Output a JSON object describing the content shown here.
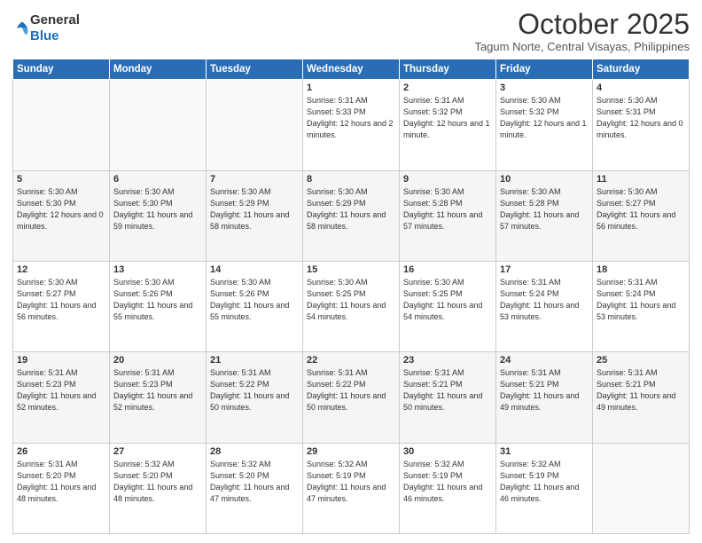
{
  "logo": {
    "general": "General",
    "blue": "Blue"
  },
  "header": {
    "month": "October 2025",
    "location": "Tagum Norte, Central Visayas, Philippines"
  },
  "weekdays": [
    "Sunday",
    "Monday",
    "Tuesday",
    "Wednesday",
    "Thursday",
    "Friday",
    "Saturday"
  ],
  "weeks": [
    [
      {
        "day": "",
        "sunrise": "",
        "sunset": "",
        "daylight": ""
      },
      {
        "day": "",
        "sunrise": "",
        "sunset": "",
        "daylight": ""
      },
      {
        "day": "",
        "sunrise": "",
        "sunset": "",
        "daylight": ""
      },
      {
        "day": "1",
        "sunrise": "Sunrise: 5:31 AM",
        "sunset": "Sunset: 5:33 PM",
        "daylight": "Daylight: 12 hours and 2 minutes."
      },
      {
        "day": "2",
        "sunrise": "Sunrise: 5:31 AM",
        "sunset": "Sunset: 5:32 PM",
        "daylight": "Daylight: 12 hours and 1 minute."
      },
      {
        "day": "3",
        "sunrise": "Sunrise: 5:30 AM",
        "sunset": "Sunset: 5:32 PM",
        "daylight": "Daylight: 12 hours and 1 minute."
      },
      {
        "day": "4",
        "sunrise": "Sunrise: 5:30 AM",
        "sunset": "Sunset: 5:31 PM",
        "daylight": "Daylight: 12 hours and 0 minutes."
      }
    ],
    [
      {
        "day": "5",
        "sunrise": "Sunrise: 5:30 AM",
        "sunset": "Sunset: 5:30 PM",
        "daylight": "Daylight: 12 hours and 0 minutes."
      },
      {
        "day": "6",
        "sunrise": "Sunrise: 5:30 AM",
        "sunset": "Sunset: 5:30 PM",
        "daylight": "Daylight: 11 hours and 59 minutes."
      },
      {
        "day": "7",
        "sunrise": "Sunrise: 5:30 AM",
        "sunset": "Sunset: 5:29 PM",
        "daylight": "Daylight: 11 hours and 58 minutes."
      },
      {
        "day": "8",
        "sunrise": "Sunrise: 5:30 AM",
        "sunset": "Sunset: 5:29 PM",
        "daylight": "Daylight: 11 hours and 58 minutes."
      },
      {
        "day": "9",
        "sunrise": "Sunrise: 5:30 AM",
        "sunset": "Sunset: 5:28 PM",
        "daylight": "Daylight: 11 hours and 57 minutes."
      },
      {
        "day": "10",
        "sunrise": "Sunrise: 5:30 AM",
        "sunset": "Sunset: 5:28 PM",
        "daylight": "Daylight: 11 hours and 57 minutes."
      },
      {
        "day": "11",
        "sunrise": "Sunrise: 5:30 AM",
        "sunset": "Sunset: 5:27 PM",
        "daylight": "Daylight: 11 hours and 56 minutes."
      }
    ],
    [
      {
        "day": "12",
        "sunrise": "Sunrise: 5:30 AM",
        "sunset": "Sunset: 5:27 PM",
        "daylight": "Daylight: 11 hours and 56 minutes."
      },
      {
        "day": "13",
        "sunrise": "Sunrise: 5:30 AM",
        "sunset": "Sunset: 5:26 PM",
        "daylight": "Daylight: 11 hours and 55 minutes."
      },
      {
        "day": "14",
        "sunrise": "Sunrise: 5:30 AM",
        "sunset": "Sunset: 5:26 PM",
        "daylight": "Daylight: 11 hours and 55 minutes."
      },
      {
        "day": "15",
        "sunrise": "Sunrise: 5:30 AM",
        "sunset": "Sunset: 5:25 PM",
        "daylight": "Daylight: 11 hours and 54 minutes."
      },
      {
        "day": "16",
        "sunrise": "Sunrise: 5:30 AM",
        "sunset": "Sunset: 5:25 PM",
        "daylight": "Daylight: 11 hours and 54 minutes."
      },
      {
        "day": "17",
        "sunrise": "Sunrise: 5:31 AM",
        "sunset": "Sunset: 5:24 PM",
        "daylight": "Daylight: 11 hours and 53 minutes."
      },
      {
        "day": "18",
        "sunrise": "Sunrise: 5:31 AM",
        "sunset": "Sunset: 5:24 PM",
        "daylight": "Daylight: 11 hours and 53 minutes."
      }
    ],
    [
      {
        "day": "19",
        "sunrise": "Sunrise: 5:31 AM",
        "sunset": "Sunset: 5:23 PM",
        "daylight": "Daylight: 11 hours and 52 minutes."
      },
      {
        "day": "20",
        "sunrise": "Sunrise: 5:31 AM",
        "sunset": "Sunset: 5:23 PM",
        "daylight": "Daylight: 11 hours and 52 minutes."
      },
      {
        "day": "21",
        "sunrise": "Sunrise: 5:31 AM",
        "sunset": "Sunset: 5:22 PM",
        "daylight": "Daylight: 11 hours and 50 minutes."
      },
      {
        "day": "22",
        "sunrise": "Sunrise: 5:31 AM",
        "sunset": "Sunset: 5:22 PM",
        "daylight": "Daylight: 11 hours and 50 minutes."
      },
      {
        "day": "23",
        "sunrise": "Sunrise: 5:31 AM",
        "sunset": "Sunset: 5:21 PM",
        "daylight": "Daylight: 11 hours and 50 minutes."
      },
      {
        "day": "24",
        "sunrise": "Sunrise: 5:31 AM",
        "sunset": "Sunset: 5:21 PM",
        "daylight": "Daylight: 11 hours and 49 minutes."
      },
      {
        "day": "25",
        "sunrise": "Sunrise: 5:31 AM",
        "sunset": "Sunset: 5:21 PM",
        "daylight": "Daylight: 11 hours and 49 minutes."
      }
    ],
    [
      {
        "day": "26",
        "sunrise": "Sunrise: 5:31 AM",
        "sunset": "Sunset: 5:20 PM",
        "daylight": "Daylight: 11 hours and 48 minutes."
      },
      {
        "day": "27",
        "sunrise": "Sunrise: 5:32 AM",
        "sunset": "Sunset: 5:20 PM",
        "daylight": "Daylight: 11 hours and 48 minutes."
      },
      {
        "day": "28",
        "sunrise": "Sunrise: 5:32 AM",
        "sunset": "Sunset: 5:20 PM",
        "daylight": "Daylight: 11 hours and 47 minutes."
      },
      {
        "day": "29",
        "sunrise": "Sunrise: 5:32 AM",
        "sunset": "Sunset: 5:19 PM",
        "daylight": "Daylight: 11 hours and 47 minutes."
      },
      {
        "day": "30",
        "sunrise": "Sunrise: 5:32 AM",
        "sunset": "Sunset: 5:19 PM",
        "daylight": "Daylight: 11 hours and 46 minutes."
      },
      {
        "day": "31",
        "sunrise": "Sunrise: 5:32 AM",
        "sunset": "Sunset: 5:19 PM",
        "daylight": "Daylight: 11 hours and 46 minutes."
      },
      {
        "day": "",
        "sunrise": "",
        "sunset": "",
        "daylight": ""
      }
    ]
  ]
}
